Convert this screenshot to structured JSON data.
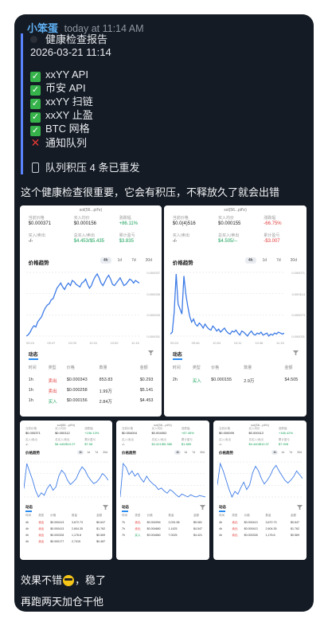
{
  "message": {
    "sender": "小笨蛋",
    "time": "today at 11:14 AM",
    "report_title": "健康检查报告",
    "report_datetime": "2026-03-21 11:14",
    "checks": [
      {
        "status": "ok",
        "label": "xxYY API"
      },
      {
        "status": "ok",
        "label": "币安 API"
      },
      {
        "status": "ok",
        "label": "xxYY 扫链"
      },
      {
        "status": "ok",
        "label": "xxXY 止盈"
      },
      {
        "status": "ok",
        "label": "BTC 网格"
      },
      {
        "status": "fail",
        "label": "通知队列"
      }
    ],
    "queue_note": "队列积压 4 条已重发"
  },
  "comment_1": "这个健康检查很重要，它会有积压，不释放久了就会出错",
  "comment_2_a": "效果不错",
  "comment_2_b": "，稳了",
  "comment_3": "再跑两天加仓干他",
  "cards": [
    {
      "token": "sol(56...pif'e)",
      "stats": [
        {
          "label": "当前价格",
          "value": "$0.000371",
          "color": "default"
        },
        {
          "label": "买入均价",
          "value": "$0.000156",
          "color": "default"
        },
        {
          "label": "涨跌幅",
          "value": "+86.11%",
          "color": "green"
        },
        {
          "label": "买入/卖出",
          "value": "-/-",
          "color": "default"
        },
        {
          "label": "总买入/卖出",
          "value": "$4.453/$5.435",
          "color": "green"
        },
        {
          "label": "累计盈亏",
          "value": "$3.835",
          "color": "green"
        }
      ],
      "chart_title": "价格趋势",
      "tabs": [
        "4h",
        "1d",
        "7d",
        "30d"
      ],
      "y_ticks": [
        "0.000037",
        "0.000035",
        "0.000033",
        "0.000031"
      ],
      "x_ticks": [
        "09:24",
        "09:47",
        "10:09",
        "10:31",
        "10:52",
        "11:15"
      ],
      "activity_title": "动态",
      "table_headers": [
        "时间",
        "类型",
        "价格",
        "数量",
        "金额"
      ],
      "rows": [
        {
          "time": "1h",
          "type": "卖出",
          "price": "$0.000343",
          "qty": "853.83",
          "amount": "$0.293",
          "side": "sell"
        },
        {
          "time": "1h",
          "type": "卖出",
          "price": "$0.000258",
          "qty": "1.99万",
          "amount": "$5.141",
          "side": "sell"
        },
        {
          "time": "1h",
          "type": "买入",
          "price": "$0.000156",
          "qty": "2.84万",
          "amount": "$4.453",
          "side": "buy"
        }
      ],
      "series": [
        33,
        34,
        36,
        39,
        41,
        40,
        44,
        46,
        48,
        52,
        55,
        57,
        58,
        61,
        62,
        66,
        70,
        72,
        74,
        71,
        69,
        72,
        74,
        72,
        76,
        75,
        73,
        72,
        71,
        74,
        75,
        77,
        73,
        70,
        72,
        76,
        79,
        81,
        78,
        74,
        72,
        75,
        78,
        80,
        77,
        73,
        72,
        74,
        76,
        78,
        75,
        72,
        73,
        75,
        77,
        76,
        74,
        76,
        75,
        74
      ]
    },
    {
      "token": "sol(56...pif'e)",
      "stats": [
        {
          "label": "当前价格",
          "value": "$0.0(4)516",
          "color": "default"
        },
        {
          "label": "买入均价",
          "value": "$0.000155",
          "color": "default"
        },
        {
          "label": "涨跌幅",
          "value": "-66.75%",
          "color": "red"
        },
        {
          "label": "买入/卖出",
          "value": "-/-",
          "color": "default"
        },
        {
          "label": "总买入/卖出",
          "value": "$4.505/--",
          "color": "green"
        },
        {
          "label": "累计盈亏",
          "value": "-$3.007",
          "color": "red"
        }
      ],
      "chart_title": "价格趋势",
      "tabs": [
        "4h",
        "1d",
        "7d",
        "30d"
      ],
      "y_ticks": [
        "0.000071",
        "0.000114",
        "0.000073",
        "0.000031"
      ],
      "x_ticks": [
        "09:24",
        "09:46",
        "10:04",
        "10:11",
        "10:46",
        "11:15"
      ],
      "activity_title": "动态",
      "table_headers": [
        "时间",
        "类型",
        "价格",
        "数量",
        "金额"
      ],
      "rows": [
        {
          "time": "2h",
          "type": "买入",
          "price": "$0.000155",
          "qty": "2.9万",
          "amount": "$4.505",
          "side": "buy"
        }
      ],
      "series": [
        30,
        32,
        52,
        90,
        60,
        55,
        50,
        88,
        70,
        58,
        48,
        42,
        45,
        40,
        38,
        41,
        39,
        36,
        40,
        37,
        35,
        34,
        38,
        36,
        33,
        35,
        32,
        34,
        36,
        33,
        31,
        30,
        33,
        32,
        34,
        31,
        29,
        33,
        32,
        30,
        28,
        31,
        33,
        30,
        29,
        31,
        30,
        32,
        29,
        30,
        31,
        28,
        30,
        29,
        31,
        30,
        32,
        31,
        30,
        31
      ]
    },
    {
      "token": "sol(56...pif'e)",
      "stats": [
        {
          "label": "当前价格",
          "value": "$0.000371",
          "color": "default"
        },
        {
          "label": "买入均价",
          "value": "$0.000112",
          "color": "default"
        },
        {
          "label": "涨跌幅",
          "value": "+196.13%",
          "color": "green"
        },
        {
          "label": "买入/卖出",
          "value": "-/-",
          "color": "default"
        },
        {
          "label": "总买入/卖出",
          "value": "$4.440/$10.07",
          "color": "green"
        },
        {
          "label": "累计盈亏",
          "value": "$7.08",
          "color": "green"
        }
      ],
      "chart_title": "价格趋势",
      "tabs": [
        "4h",
        "1d",
        "7d",
        "30d"
      ],
      "activity_title": "动态",
      "table_headers": [
        "时间",
        "类型",
        "价格",
        "数量",
        "金额"
      ],
      "rows": [
        {
          "time": "4h",
          "type": "卖出",
          "price": "$0.000413",
          "qty": "3,672.73",
          "amount": "$0.647"
        },
        {
          "time": "4h",
          "type": "卖出",
          "price": "$0.000413",
          "qty": "2,604.35",
          "amount": "$1.762"
        },
        {
          "time": "4h",
          "type": "卖出",
          "price": "$0.000328",
          "qty": "1,176.8",
          "amount": "$0.569"
        },
        {
          "time": "4h",
          "type": "卖出",
          "price": "$0.000177",
          "qty": "2,7415",
          "amount": "$0.487"
        }
      ],
      "series": [
        40,
        70,
        60,
        50,
        38,
        30,
        35,
        32,
        40,
        45,
        38,
        42,
        55,
        62,
        58,
        50,
        45,
        48,
        52,
        60,
        66,
        62,
        55,
        50,
        46,
        48,
        52,
        58,
        55,
        50
      ]
    },
    {
      "token": "sol(56...pif'e)",
      "stats": [
        {
          "label": "当前价格",
          "value": "$0.004004",
          "color": "default"
        },
        {
          "label": "买入均价",
          "value": "$0.004002",
          "color": "default"
        },
        {
          "label": "涨跌幅",
          "value": "+87.45%",
          "color": "green"
        },
        {
          "label": "买入/卖出",
          "value": "-/-",
          "color": "default"
        },
        {
          "label": "总买入/卖出",
          "value": "$4.421/$5.386",
          "color": "green"
        },
        {
          "label": "累计盈亏",
          "value": "$1.689",
          "color": "green"
        }
      ],
      "chart_title": "价格趋势",
      "tabs": [
        "4h",
        "1d",
        "7d",
        "30d"
      ],
      "activity_title": "动态",
      "table_headers": [
        "时间",
        "类型",
        "价格",
        "数量",
        "金额"
      ],
      "rows": [
        {
          "time": "7h",
          "type": "卖出",
          "price": "$0.004994",
          "qty": "2,031.58",
          "amount": "$5.081"
        },
        {
          "time": "7h",
          "type": "卖出",
          "price": "$0.004660",
          "qty": "1.1425",
          "amount": "$4.547"
        },
        {
          "time": "7h",
          "type": "买入",
          "price": "$0.004660",
          "qty": "7.0025",
          "amount": "$4.421"
        }
      ],
      "series": [
        30,
        75,
        70,
        60,
        65,
        58,
        62,
        55,
        50,
        58,
        52,
        48,
        45,
        40,
        42,
        38,
        35,
        40,
        37,
        33,
        30,
        34,
        32,
        30,
        33,
        31,
        30,
        32,
        31,
        30
      ]
    },
    {
      "token": "sol(56...pif'e)",
      "stats": [
        {
          "label": "当前价格",
          "value": "$0.000099",
          "color": "default"
        },
        {
          "label": "买入均价",
          "value": "$0.000112",
          "color": "default"
        },
        {
          "label": "涨跌幅",
          "value": "+165.42%",
          "color": "green"
        },
        {
          "label": "买入/卖出",
          "value": "-/-",
          "color": "default"
        },
        {
          "label": "总买入/卖出",
          "value": "$4.440/$10.07",
          "color": "green"
        },
        {
          "label": "累计盈亏",
          "value": "$7.928",
          "color": "green"
        }
      ],
      "chart_title": "价格趋势",
      "tabs": [
        "4h",
        "1d",
        "7d",
        "30d"
      ],
      "activity_title": "动态",
      "table_headers": [
        "时间",
        "类型",
        "价格",
        "数量",
        "金额"
      ],
      "rows": [
        {
          "time": "4h",
          "type": "卖出",
          "price": "$0.000413",
          "qty": "3,672.73",
          "amount": "$0.647"
        },
        {
          "time": "4h",
          "type": "卖出",
          "price": "$0.000413",
          "qty": "2,604.35",
          "amount": "$1.762"
        },
        {
          "time": "4h",
          "type": "卖出",
          "price": "$0.000328",
          "qty": "1,176.8",
          "amount": "$0.569"
        }
      ],
      "series": [
        45,
        68,
        60,
        50,
        40,
        32,
        38,
        35,
        42,
        48,
        40,
        45,
        58,
        65,
        60,
        52,
        46,
        50,
        55,
        62,
        66,
        60,
        55,
        50,
        47,
        50,
        54,
        60,
        56,
        52
      ]
    }
  ]
}
